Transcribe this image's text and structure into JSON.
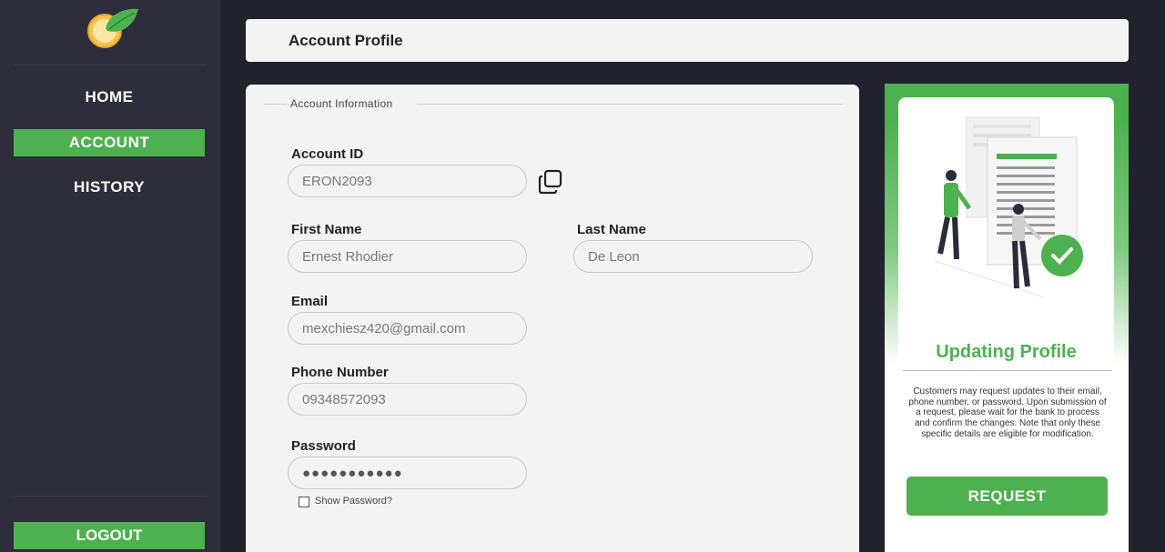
{
  "sidebar": {
    "logo_icon": "coin-leaf-icon",
    "nav": [
      {
        "label": "HOME"
      },
      {
        "label": "ACCOUNT"
      },
      {
        "label": "HISTORY"
      }
    ],
    "active_index": 1,
    "logout_label": "LOGOUT"
  },
  "header": {
    "title": "Account Profile"
  },
  "form": {
    "legend": "Account Information",
    "account_id": {
      "label": "Account ID",
      "value": "ERON2093"
    },
    "first_name": {
      "label": "First Name",
      "value": "Ernest Rhodier"
    },
    "last_name": {
      "label": "Last Name",
      "value": "De Leon"
    },
    "email": {
      "label": "Email",
      "value": "mexchiesz420@gmail.com"
    },
    "phone": {
      "label": "Phone Number",
      "value": "09348572093"
    },
    "password": {
      "label": "Password",
      "value": "●●●●●●●●●●●"
    },
    "show_password_label": "Show Password?",
    "copy_icon": "copy-icon"
  },
  "panel": {
    "title": "Updating Profile",
    "description": "Customers may request updates to their email, phone number, or password. Upon submission of a request, please wait for the bank to process and confirm the changes. Note that only these specific details are eligible for modification.",
    "button_label": "REQUEST",
    "illustration_icon": "document-approval-illustration"
  },
  "colors": {
    "accent": "#4db14f",
    "sidebar_bg": "#2d2d3c",
    "page_bg": "#22222f",
    "card_bg": "#f3f3f3"
  }
}
